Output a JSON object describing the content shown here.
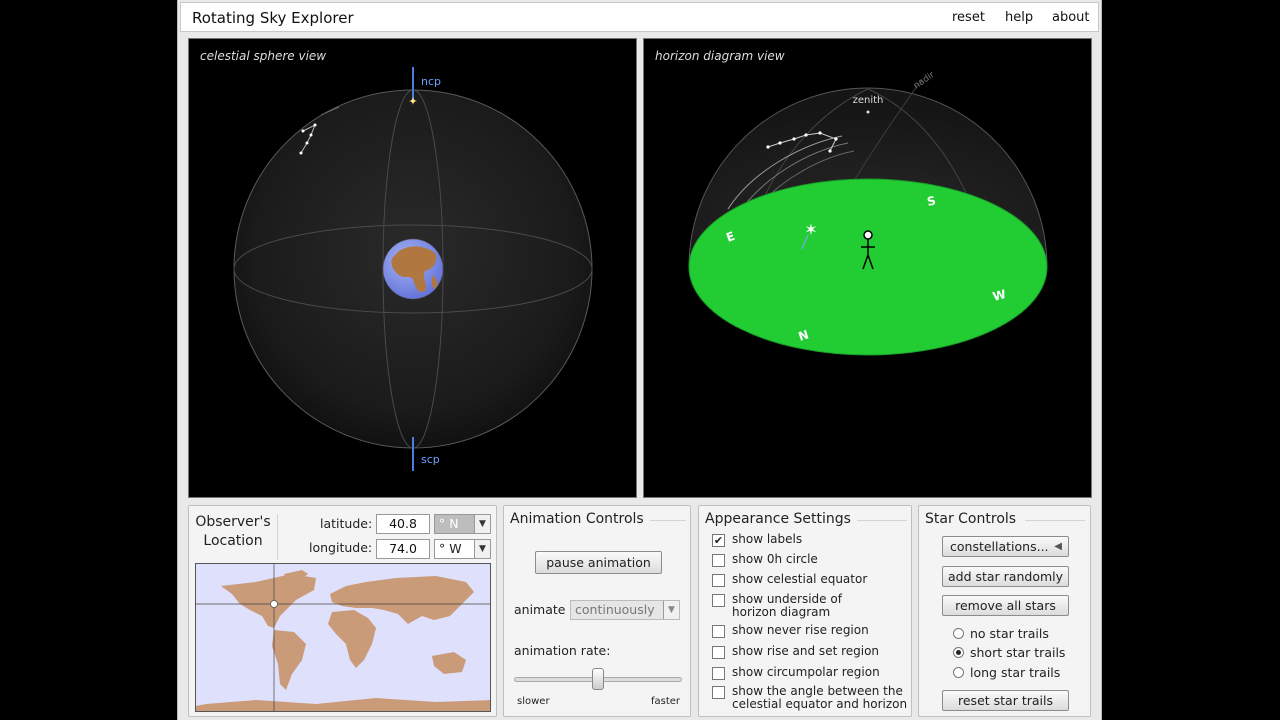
{
  "app": {
    "title": "Rotating Sky Explorer",
    "menu": {
      "reset": "reset",
      "help": "help",
      "about": "about"
    }
  },
  "sphere_view": {
    "title": "celestial sphere view",
    "ncp_label": "ncp",
    "scp_label": "scp"
  },
  "horizon_view": {
    "title": "horizon diagram view",
    "zenith_label": "zenith",
    "nadir_label": "nadir",
    "directions": {
      "north": "N",
      "south": "S",
      "east": "E",
      "west": "W"
    }
  },
  "observer": {
    "heading_line1": "Observer's",
    "heading_line2": "Location",
    "latitude_label": "latitude:",
    "latitude_value": "40.8",
    "latitude_dir": "° N",
    "longitude_label": "longitude:",
    "longitude_value": "74.0",
    "longitude_dir": "° W"
  },
  "animation": {
    "heading": "Animation Controls",
    "pause_button": "pause animation",
    "animate_label": "animate",
    "animate_mode": "continuously",
    "rate_label": "animation rate:",
    "rate_fraction": 0.5,
    "slower_label": "slower",
    "faster_label": "faster"
  },
  "appearance": {
    "heading": "Appearance Settings",
    "options": [
      {
        "line1": "show labels",
        "line2": "",
        "checked": true
      },
      {
        "line1": "show 0h circle",
        "line2": "",
        "checked": false
      },
      {
        "line1": "show celestial equator",
        "line2": "",
        "checked": false
      },
      {
        "line1": "show underside of",
        "line2": "horizon diagram",
        "checked": false
      },
      {
        "line1": "show never rise region",
        "line2": "",
        "checked": false
      },
      {
        "line1": "show rise and set region",
        "line2": "",
        "checked": false
      },
      {
        "line1": "show circumpolar region",
        "line2": "",
        "checked": false
      },
      {
        "line1": "show the angle between the",
        "line2": "celestial equator and horizon",
        "checked": false
      }
    ]
  },
  "stars": {
    "heading": "Star Controls",
    "constellations_button": "constellations...",
    "add_star_button": "add star randomly",
    "remove_stars_button": "remove all stars",
    "trail_options": [
      "no star trails",
      "short star trails",
      "long star trails"
    ],
    "selected_trail": 1,
    "reset_trails_button": "reset star trails"
  },
  "colors": {
    "ground": "#22cc33",
    "earth_ocean": "#7f8ee8",
    "earth_land": "#b07840",
    "map_ocean": "#dfe0fb",
    "map_land": "#c99b78",
    "pole_marker": "#4a7fe0"
  }
}
